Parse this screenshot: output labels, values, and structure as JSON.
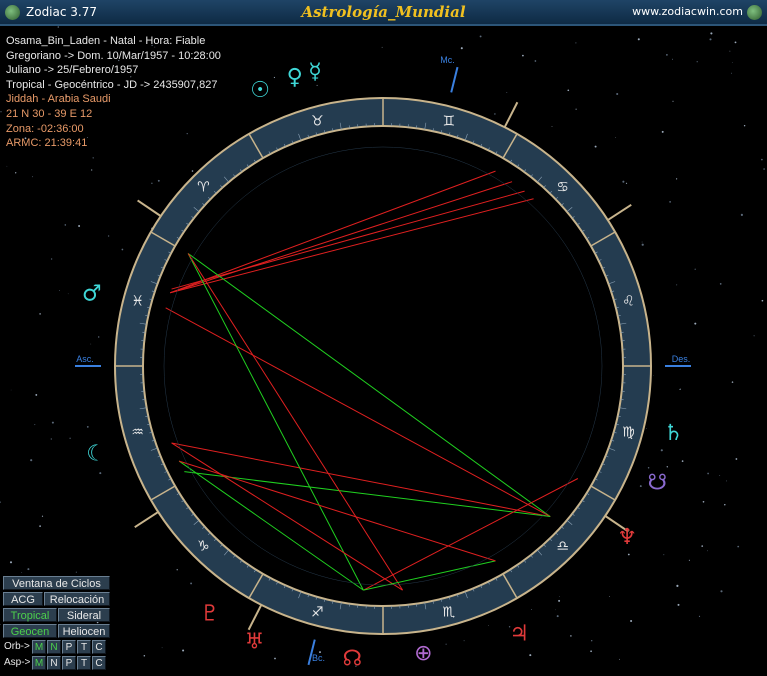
{
  "window": {
    "app_name": "Zodiac 3.77",
    "title": "Astrología_Mundial",
    "url": "www.zodiacwin.com"
  },
  "info": {
    "line1": "Osama_Bin_Laden - Natal - Hora: Fiable",
    "line2": "Gregoriano -> Dom. 10/Mar/1957 - 10:28:00",
    "line3": "Juliano -> 25/Febrero/1957",
    "line4": "Tropical - Geocéntrico - JD -> 2435907,827",
    "line5": "Jiddah - Arabia Saudi",
    "line6": "21 N 30 - 39 E 12",
    "line7": "Zona: -02:36:00",
    "line8": "ARMC: 21:39:41"
  },
  "axes": {
    "asc": "Asc.",
    "des": "Des.",
    "mc": "Mc.",
    "bc": "Bc."
  },
  "signs": [
    "♈",
    "♉",
    "♊",
    "♋",
    "♌",
    "♍",
    "♎",
    "♏",
    "♐",
    "♑",
    "♒",
    "♓"
  ],
  "planets": [
    {
      "name": "sun",
      "glyph": "☉",
      "color": "#3fd7d7"
    },
    {
      "name": "venus",
      "glyph": "♀",
      "color": "#3fd7d7"
    },
    {
      "name": "mercury",
      "glyph": "☿",
      "color": "#3fd7d7"
    },
    {
      "name": "mars",
      "glyph": "♂",
      "color": "#3fd7d7"
    },
    {
      "name": "moon",
      "glyph": "☾",
      "color": "#3fd7d7"
    },
    {
      "name": "saturn",
      "glyph": "♄",
      "color": "#3fd7d7"
    },
    {
      "name": "neptune",
      "glyph": "♆",
      "color": "#e03a3a"
    },
    {
      "name": "pluto",
      "glyph": "♇",
      "color": "#e03a3a"
    },
    {
      "name": "uranus",
      "glyph": "♅",
      "color": "#e03a3a"
    },
    {
      "name": "jupiter",
      "glyph": "♃",
      "color": "#e03a3a"
    },
    {
      "name": "node",
      "glyph": "☊",
      "color": "#e03a3a"
    },
    {
      "name": "fortune",
      "glyph": "⊕",
      "color": "#b06ad0"
    },
    {
      "name": "lilith",
      "glyph": "☋",
      "color": "#8a6ad0"
    }
  ],
  "panel": {
    "ventana": "Ventana de Ciclos",
    "acg": "ACG",
    "relocacion": "Relocación",
    "tropical": "Tropical",
    "sideral": "Sideral",
    "geocen": "Geocen",
    "heliocen": "Heliocen",
    "orb": "Orb->",
    "asp": "Asp->",
    "m": "M",
    "n": "N",
    "p": "P",
    "t": "T",
    "c": "C"
  },
  "colors": {
    "accent": "#f0c020",
    "ring": "#243c50",
    "aspect_red": "#e02020",
    "aspect_green": "#20d020",
    "axis_blue": "#3a80e0"
  }
}
